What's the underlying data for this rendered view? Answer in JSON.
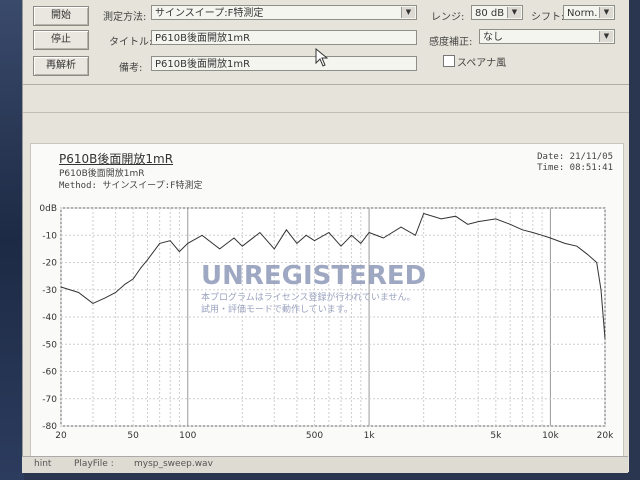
{
  "toolbar": {
    "start_label": "開始",
    "stop_label": "停止",
    "reanalyze_label": "再解析"
  },
  "settings": {
    "method_label": "測定方法:",
    "method_value": "サインスイープ:F特測定",
    "title_label": "タイトル:",
    "title_value": "P610B後面開放1mR",
    "memo_label": "備考:",
    "memo_value": "P610B後面開放1mR",
    "range_label": "レンジ:",
    "range_value": "80 dB",
    "shift_label": "シフト:",
    "shift_value": "Norm.",
    "sens_label": "感度補正:",
    "sens_value": "なし",
    "spectrum_label": "スペアナ風",
    "spectrum_checked": false
  },
  "graph": {
    "title": "P610B後面開放1mR",
    "subtitle": "P610B後面開放1mR",
    "method": "Method: サインスイープ:F特測定",
    "date": "Date: 21/11/05",
    "time": "Time: 08:51:41",
    "watermark": "UNREGISTERED",
    "notice_line1": "本プログラムはライセンス登録が行われていません。",
    "notice_line2": "試用・評価モードで動作しています。"
  },
  "chart_data": {
    "type": "line",
    "title": "P610B後面開放1mR",
    "xlabel": "",
    "ylabel": "",
    "x_scale": "log",
    "xlim": [
      20,
      20000
    ],
    "ylim": [
      -80,
      0
    ],
    "grid": true,
    "x_ticks": [
      "20",
      "50",
      "100",
      "500",
      "1k",
      "5k",
      "10k",
      "20k"
    ],
    "y_ticks": [
      "0dB",
      "-10",
      "-20",
      "-30",
      "-40",
      "-50",
      "-60",
      "-70",
      "-80"
    ],
    "series": [
      {
        "x": [
          20,
          25,
          30,
          35,
          40,
          45,
          50,
          55,
          60,
          70,
          80,
          90,
          100,
          120,
          150,
          180,
          200,
          250,
          300,
          350,
          400,
          450,
          500,
          600,
          700,
          800,
          900,
          1000,
          1200,
          1500,
          1800,
          2000,
          2500,
          3000,
          3500,
          4000,
          5000,
          6000,
          7000,
          8000,
          9000,
          10000,
          12000,
          14000,
          16000,
          18000,
          19000,
          20000
        ],
        "y": [
          -29,
          -31,
          -35,
          -33,
          -31,
          -28,
          -26,
          -22,
          -19,
          -13,
          -12,
          -16,
          -13,
          -10,
          -15,
          -11,
          -14,
          -9,
          -15,
          -8,
          -13,
          -10,
          -12,
          -9,
          -14,
          -10,
          -13,
          -9,
          -11,
          -7,
          -10,
          -2,
          -4,
          -3,
          -6,
          -5,
          -4,
          -6,
          -8,
          -9,
          -10,
          -11,
          -13,
          -14,
          -17,
          -20,
          -30,
          -48
        ]
      }
    ]
  },
  "status": {
    "hint": "hint",
    "playfile_label": "PlayFile :",
    "playfile_value": "mysp_sweep.wav"
  }
}
